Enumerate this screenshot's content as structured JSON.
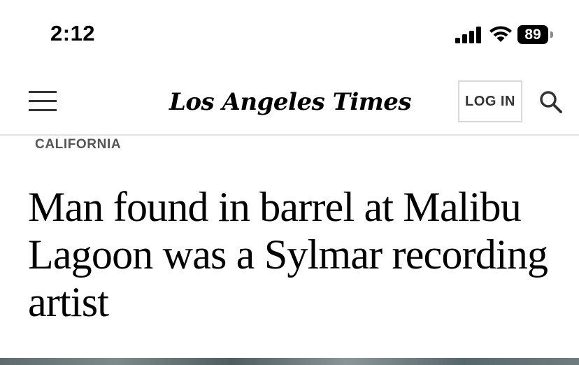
{
  "status_bar": {
    "time": "2:12",
    "battery_level": "89"
  },
  "header": {
    "masthead": "Los Angeles Times",
    "login_label": "LOG IN",
    "menu_icon": "hamburger-menu-icon",
    "search_icon": "search-icon"
  },
  "article": {
    "section": "CALIFORNIA",
    "headline": "Man found in barrel at Malibu Lagoon was a Sylmar recording artist"
  }
}
